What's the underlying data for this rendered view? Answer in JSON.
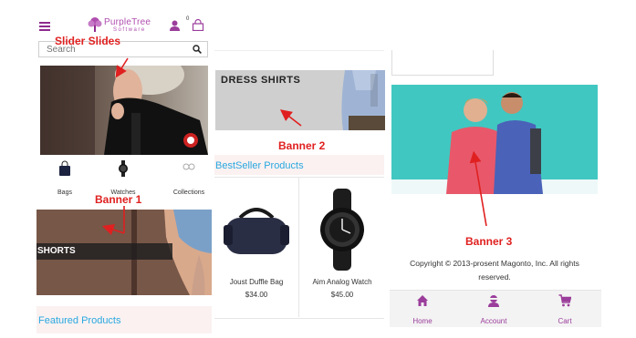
{
  "header": {
    "logo_text": "PurpleTree",
    "logo_sub": "Software",
    "cart_count": "0"
  },
  "search": {
    "placeholder": "Search"
  },
  "categories": [
    {
      "label": "Bags",
      "icon": "bag-icon"
    },
    {
      "label": "Watches",
      "icon": "watch-icon"
    },
    {
      "label": "Collections",
      "icon": "collections-icon"
    }
  ],
  "banners": {
    "banner1_label": "SHORTS",
    "banner2_label": "DRESS SHIRTS"
  },
  "sections": {
    "featured": "Featured Products",
    "bestseller": "BestSeller Products"
  },
  "products": [
    {
      "name": "Joust Duffle Bag",
      "price": "$34.00"
    },
    {
      "name": "Aim Analog Watch",
      "price": "$45.00"
    }
  ],
  "footer": {
    "copyright_line1": "Copyright © 2013-prosent Magonto, Inc. All rights",
    "copyright_line2": "reserved."
  },
  "bottom_nav": [
    {
      "label": "Home",
      "icon": "home-icon"
    },
    {
      "label": "Account",
      "icon": "account-icon"
    },
    {
      "label": "Cart",
      "icon": "cart-icon"
    }
  ],
  "annotations": {
    "slider": "Slider Slides",
    "banner1": "Banner 1",
    "banner2": "Banner 2",
    "banner3": "Banner 3"
  },
  "colors": {
    "brand_purple": "#9b3d9b",
    "accent_blue": "#29a8e0",
    "annotation_red": "#e02020",
    "banner3_bg": "#37c2bd"
  }
}
